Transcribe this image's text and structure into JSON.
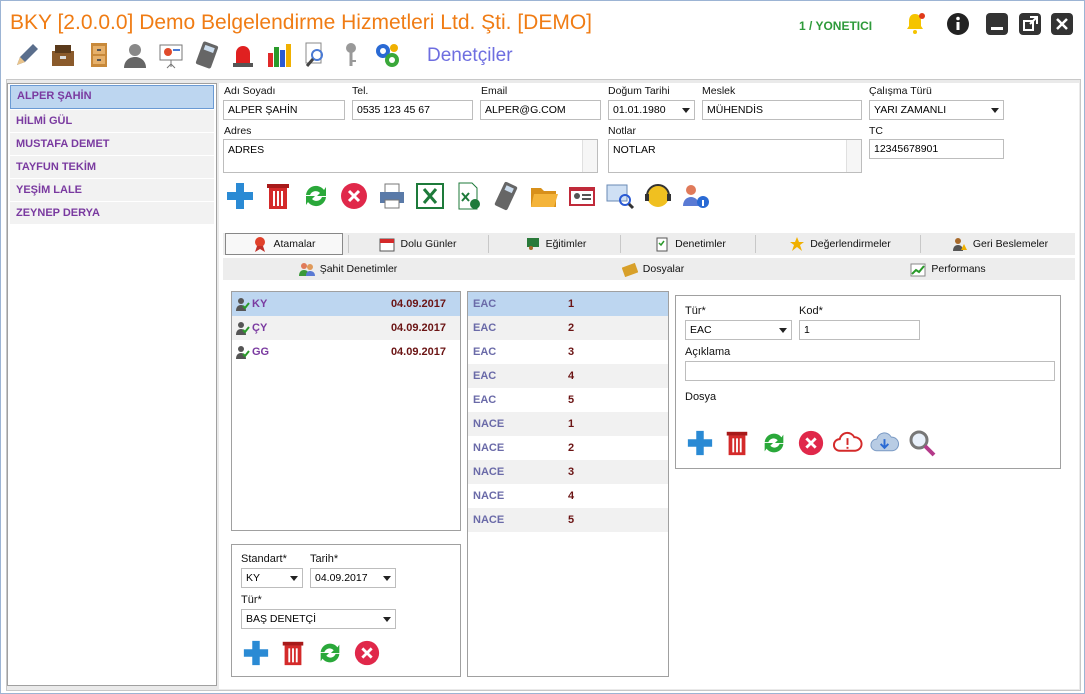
{
  "app": {
    "title": "BKY [2.0.0.0] Demo Belgelendirme Hizmetleri Ltd. Şti. [DEMO]",
    "user": "1 / YONETICI",
    "section_title": "Denetçiler"
  },
  "toolbar_icons": [
    "pen-icon",
    "archive-box-icon",
    "file-cabinet-icon",
    "person-icon",
    "presentation-icon",
    "calculator-icon",
    "alarm-light-icon",
    "bar-chart-icon",
    "document-search-icon",
    "key-icon",
    "gears-icon"
  ],
  "auditors": [
    {
      "name": "ALPER ŞAHİN",
      "selected": true
    },
    {
      "name": "HİLMİ GÜL",
      "selected": false
    },
    {
      "name": "MUSTAFA DEMET",
      "selected": false
    },
    {
      "name": "TAYFUN TEKİM",
      "selected": false
    },
    {
      "name": "YEŞİM LALE",
      "selected": false
    },
    {
      "name": "ZEYNEP DERYA",
      "selected": false
    }
  ],
  "form": {
    "name_label": "Adı Soyadı",
    "name_value": "ALPER ŞAHİN",
    "phone_label": "Tel.",
    "phone_value": "0535 123 45 67",
    "email_label": "Email",
    "email_value": "ALPER@G.COM",
    "birth_label": "Doğum Tarihi",
    "birth_value": "01.01.1980",
    "job_label": "Meslek",
    "job_value": "MÜHENDİS",
    "worktype_label": "Çalışma Türü",
    "worktype_value": "YARI ZAMANLI",
    "address_label": "Adres",
    "address_value": "ADRES",
    "notes_label": "Notlar",
    "notes_value": "NOTLAR",
    "tc_label": "TC",
    "tc_value": "12345678901"
  },
  "tabs_row1": [
    {
      "label": "Atamalar",
      "icon": "ribbon-icon",
      "active": true
    },
    {
      "label": "Dolu Günler",
      "icon": "calendar-icon",
      "active": false
    },
    {
      "label": "Eğitimler",
      "icon": "teacher-icon",
      "active": false
    },
    {
      "label": "Denetimler",
      "icon": "clipboard-icon",
      "active": false
    },
    {
      "label": "Değerlendirmeler",
      "icon": "star-icon",
      "active": false
    },
    {
      "label": "Geri Beslemeler",
      "icon": "user-warning-icon",
      "active": false
    }
  ],
  "tabs_row2": [
    {
      "label": "Şahit Denetimler",
      "icon": "users-icon"
    },
    {
      "label": "Dosyalar",
      "icon": "folder-icon"
    },
    {
      "label": "Performans",
      "icon": "chart-up-icon"
    }
  ],
  "assignments": [
    {
      "standard": "KY",
      "date": "04.09.2017"
    },
    {
      "standard": "ÇY",
      "date": "04.09.2017"
    },
    {
      "standard": "GG",
      "date": "04.09.2017"
    }
  ],
  "codes": [
    {
      "type": "EAC",
      "code": "1"
    },
    {
      "type": "EAC",
      "code": "2"
    },
    {
      "type": "EAC",
      "code": "3"
    },
    {
      "type": "EAC",
      "code": "4"
    },
    {
      "type": "EAC",
      "code": "5"
    },
    {
      "type": "NACE",
      "code": "1"
    },
    {
      "type": "NACE",
      "code": "2"
    },
    {
      "type": "NACE",
      "code": "3"
    },
    {
      "type": "NACE",
      "code": "4"
    },
    {
      "type": "NACE",
      "code": "5"
    }
  ],
  "assign_form": {
    "standard_label": "Standart*",
    "standard_value": "KY",
    "date_label": "Tarih*",
    "date_value": "04.09.2017",
    "type_label": "Tür*",
    "type_value": "BAŞ DENETÇİ"
  },
  "code_form": {
    "type_label": "Tür*",
    "type_value": "EAC",
    "code_label": "Kod*",
    "code_value": "1",
    "desc_label": "Açıklama",
    "desc_value": "",
    "file_label": "Dosya"
  }
}
